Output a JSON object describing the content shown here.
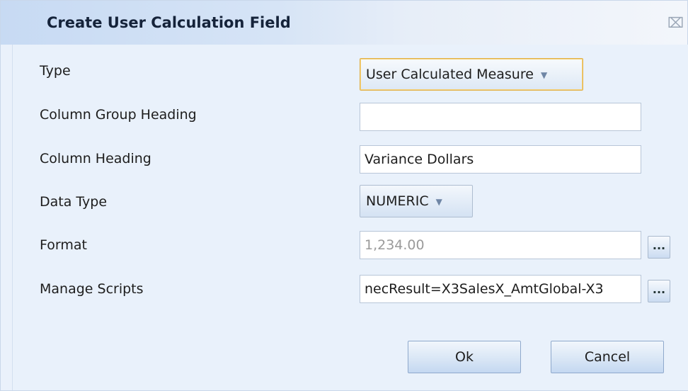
{
  "dialog": {
    "title": "Create User Calculation Field",
    "close_symbol": "⌧"
  },
  "form": {
    "type": {
      "label": "Type",
      "value": "User Calculated Measure"
    },
    "column_group_heading": {
      "label": "Column Group Heading",
      "value": ""
    },
    "column_heading": {
      "label": "Column Heading",
      "value": "Variance Dollars"
    },
    "data_type": {
      "label": "Data Type",
      "value": "NUMERIC"
    },
    "format": {
      "label": "Format",
      "value": "1,234.00",
      "button": "..."
    },
    "manage_scripts": {
      "label": "Manage Scripts",
      "value": "necResult=X3SalesX_AmtGlobal-X3",
      "button": "..."
    }
  },
  "buttons": {
    "ok": "Ok",
    "cancel": "Cancel"
  },
  "icons": {
    "close": "close-icon",
    "dropdown": "chevron-down-icon"
  }
}
